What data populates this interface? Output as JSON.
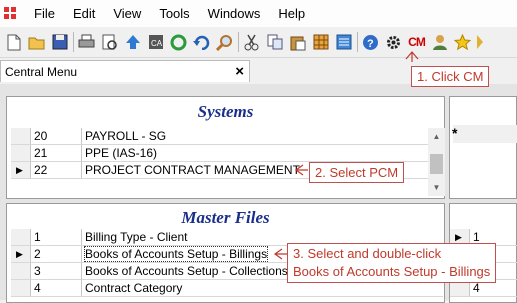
{
  "menu": [
    "File",
    "Edit",
    "View",
    "Tools",
    "Windows",
    "Help"
  ],
  "toolbar": {
    "icons": [
      "new-icon",
      "open-folder-icon",
      "save-icon",
      "print-icon",
      "print-preview-icon",
      "upload-icon",
      "calculator-icon",
      "refresh-icon",
      "undo-icon",
      "search-icon",
      "cut-icon",
      "copy-icon",
      "paste-icon",
      "grid-icon",
      "list-icon",
      "help-icon",
      "gear-icon",
      "cm-icon",
      "user-icon",
      "star-icon"
    ],
    "cm_label": "CM"
  },
  "tab": {
    "label": "Central Menu",
    "close": "×"
  },
  "systems": {
    "title": "Systems",
    "rows": [
      {
        "code": "20",
        "name": "PAYROLL - SG",
        "indicator": ""
      },
      {
        "code": "21",
        "name": "PPE (IAS-16)",
        "indicator": ""
      },
      {
        "code": "22",
        "name": "PROJECT CONTRACT MANAGEMENT",
        "indicator": "▶"
      }
    ]
  },
  "master_files": {
    "title": "Master Files",
    "rows": [
      {
        "code": "1",
        "name": "Billing Type - Client",
        "indicator": ""
      },
      {
        "code": "2",
        "name": "Books  of Accounts Setup - Billings",
        "indicator": "▶"
      },
      {
        "code": "3",
        "name": "Books of Accounts Setup - Collections",
        "indicator": ""
      },
      {
        "code": "4",
        "name": "Contract Category",
        "indicator": ""
      }
    ]
  },
  "right_panel": {
    "top_marker": "*",
    "bottom_rows": [
      {
        "indicator": "▶",
        "code": "1"
      },
      {
        "indicator": "",
        "code": "2"
      },
      {
        "indicator": "",
        "code": "3"
      },
      {
        "indicator": "",
        "code": "4"
      }
    ]
  },
  "callouts": {
    "step1": "1. Click CM",
    "step2": "2. Select PCM",
    "step3_line1": "3. Select and double-click",
    "step3_line2": "Books of Accounts Setup - Billings"
  },
  "colors": {
    "title": "#1a2f8a",
    "callout": "#c0392b"
  }
}
